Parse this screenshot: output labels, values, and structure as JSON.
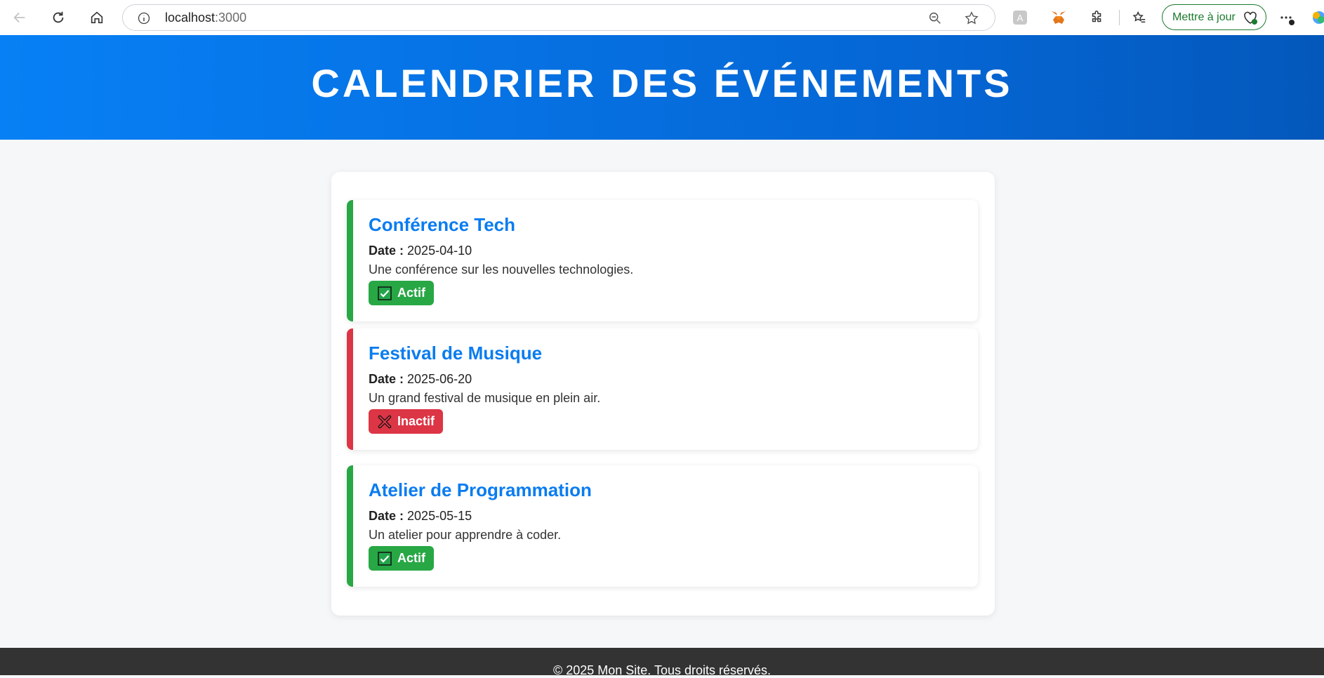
{
  "browser": {
    "url_host": "localhost",
    "url_port": ":3000",
    "update_label": "Mettre à jour"
  },
  "header": {
    "title": "CALENDRIER DES ÉVÉNEMENTS"
  },
  "events": [
    {
      "title": "Conférence Tech",
      "date_label": "Date :",
      "date": "2025-04-10",
      "description": "Une conférence sur les nouvelles technologies.",
      "status": "Actif",
      "active": true
    },
    {
      "title": "Festival de Musique",
      "date_label": "Date :",
      "date": "2025-06-20",
      "description": "Un grand festival de musique en plein air.",
      "status": "Inactif",
      "active": false
    },
    {
      "title": "Atelier de Programmation",
      "date_label": "Date :",
      "date": "2025-05-15",
      "description": "Un atelier pour apprendre à coder.",
      "status": "Actif",
      "active": true
    }
  ],
  "footer": {
    "text": "© 2025 Mon Site. Tous droits réservés."
  },
  "colors": {
    "active": "#28a745",
    "inactive": "#dc3545",
    "title_blue": "#0a7cf0",
    "header_blue": "#0566d4"
  }
}
